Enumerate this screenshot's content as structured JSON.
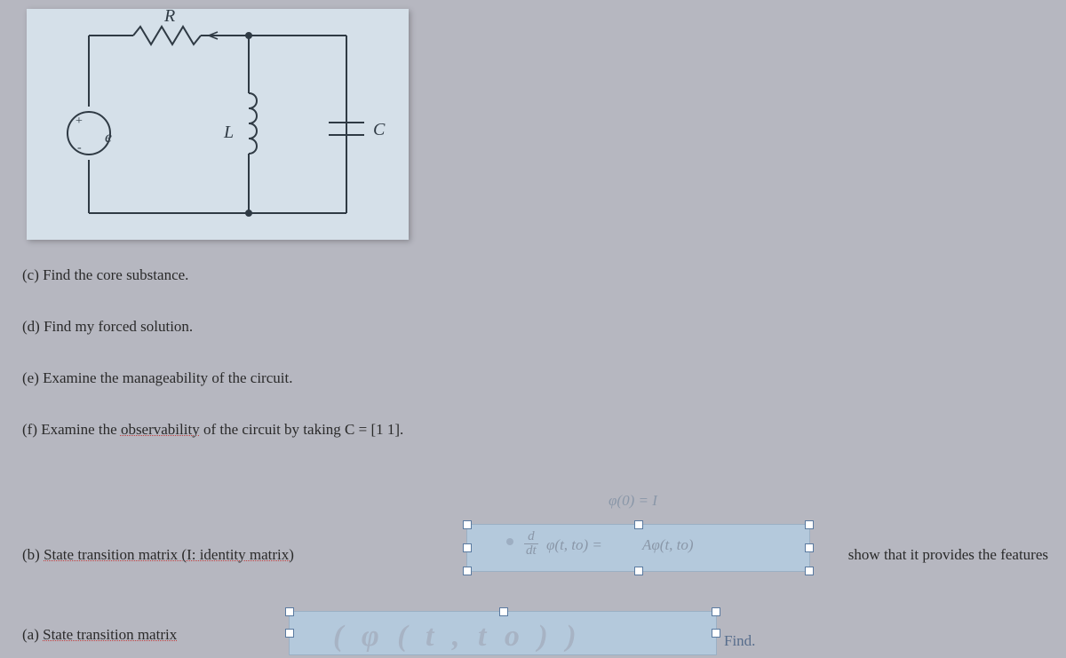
{
  "circuit": {
    "R": "R",
    "L": "L",
    "C": "C",
    "e": "e",
    "plus": "+",
    "minus": "-"
  },
  "questions": {
    "c": "(c) Find the core substance.",
    "d": "(d) Find my forced solution.",
    "e": "(e) Examine the manageability of the circuit.",
    "f_prefix": "(f) Examine the ",
    "f_dotted": "observability",
    "f_suffix": " of the circuit by taking C = [1 1]."
  },
  "row_b": {
    "prefix": "(b) ",
    "dotted": "State transition matrix (I: identity matrix)",
    "show": "show that it provides the features",
    "eq1": "φ(0) = I",
    "eq2_mid": "φ(t, to) =",
    "eq2_right": "Aφ(t, to)",
    "frac_n": "d",
    "frac_d": "dt"
  },
  "row_a": {
    "prefix": "(a) ",
    "dotted": "State transition matrix",
    "find": "Find.",
    "bigphi": "( φ ( t ,  t o ) )"
  }
}
